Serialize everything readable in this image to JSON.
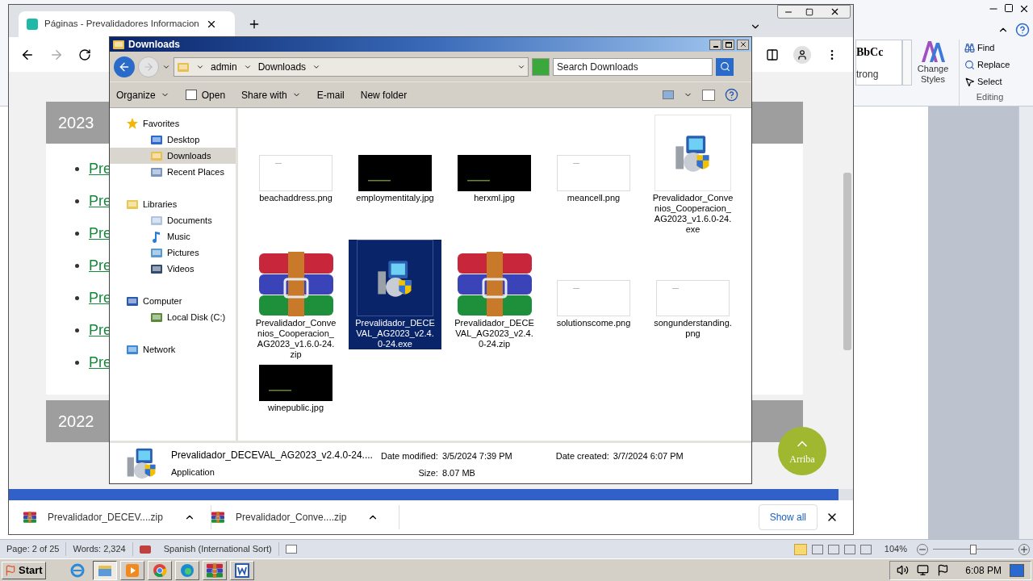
{
  "word": {
    "ribbon": {
      "style_preview": "BbCc",
      "style_name": "trong",
      "change_styles": "Change Styles",
      "find": "Find",
      "replace": "Replace",
      "select": "Select",
      "group_label": "Editing"
    },
    "status_bar": {
      "page": "Page: 2 of 25",
      "words": "Words: 2,324",
      "language": "Spanish (International Sort)",
      "zoom": "104%",
      "zoom_slider": {
        "level": 0.5
      }
    }
  },
  "browser": {
    "tab": {
      "title": "Páginas - Prevalidadores Informacion"
    },
    "sections": [
      {
        "year": "2023",
        "links": [
          "Pre",
          "Pre",
          "Pre",
          "Pre",
          "Pre",
          "Pre",
          "Pre"
        ]
      },
      {
        "year": "2022"
      }
    ],
    "back_to_top": "Arriba",
    "downloads": [
      {
        "name": "Prevalidador_DECEV....zip"
      },
      {
        "name": "Prevalidador_Conve....zip"
      }
    ],
    "show_all": "Show all"
  },
  "explorer": {
    "title": "Downloads",
    "breadcrumb": [
      "admin",
      "Downloads"
    ],
    "search": {
      "placeholder": "Search Downloads"
    },
    "toolbar": [
      {
        "label": "Organize",
        "kind": "menu"
      },
      {
        "label": "Open",
        "kind": "icon"
      },
      {
        "label": "Share with",
        "kind": "menu"
      },
      {
        "label": "E-mail",
        "kind": "plain"
      },
      {
        "label": "New folder",
        "kind": "plain"
      }
    ],
    "nav": [
      {
        "label": "Favorites",
        "kind": "star",
        "selected": false,
        "children": [
          {
            "label": "Desktop",
            "kind": "desktop",
            "selected": false
          },
          {
            "label": "Downloads",
            "kind": "downloads",
            "selected": true
          },
          {
            "label": "Recent Places",
            "kind": "recent",
            "selected": false
          }
        ]
      },
      {
        "label": "Libraries",
        "kind": "libraries",
        "selected": false,
        "children": [
          {
            "label": "Documents",
            "kind": "documents",
            "selected": false
          },
          {
            "label": "Music",
            "kind": "music",
            "selected": false
          },
          {
            "label": "Pictures",
            "kind": "pictures",
            "selected": false
          },
          {
            "label": "Videos",
            "kind": "videos",
            "selected": false
          }
        ]
      },
      {
        "label": "Computer",
        "kind": "computer",
        "selected": false,
        "children": [
          {
            "label": "Local Disk (C:)",
            "kind": "disk",
            "selected": false
          }
        ]
      },
      {
        "label": "Network",
        "kind": "network",
        "selected": false
      }
    ],
    "files": [
      {
        "name": "beachaddress.png",
        "kind": "light-image",
        "selected": false
      },
      {
        "name": "employmentitaly.jpg",
        "kind": "dark-image",
        "selected": false
      },
      {
        "name": "herxml.jpg",
        "kind": "dark-image",
        "selected": false
      },
      {
        "name": "meancell.png",
        "kind": "light-image",
        "selected": false
      },
      {
        "name": "Prevalidador_Convenios_Cooperacion_AG2023_v1.6.0-24.exe",
        "kind": "installer",
        "selected": false
      },
      {
        "name": "Prevalidador_Convenios_Cooperacion_AG2023_v1.6.0-24.zip",
        "kind": "archive",
        "selected": false
      },
      {
        "name": "Prevalidador_DECEVAL_AG2023_v2.4.0-24.exe",
        "kind": "installer",
        "selected": true
      },
      {
        "name": "Prevalidador_DECEVAL_AG2023_v2.4.0-24.zip",
        "kind": "archive",
        "selected": false
      },
      {
        "name": "solutionscome.png",
        "kind": "light-image",
        "selected": false
      },
      {
        "name": "songunderstanding.png",
        "kind": "light-image",
        "selected": false
      },
      {
        "name": "winepublic.jpg",
        "kind": "dark-image",
        "selected": false
      }
    ],
    "details": {
      "name": "Prevalidador_DECEVAL_AG2023_v2.4.0-24....",
      "type": "Application",
      "fields": [
        {
          "label": "Date modified:",
          "value": "3/5/2024 7:39 PM"
        },
        {
          "label": "Size:",
          "value": "8.07 MB"
        },
        {
          "label": "Date created:",
          "value": "3/7/2024 6:07 PM"
        }
      ]
    }
  },
  "taskbar": {
    "start": "Start",
    "clock": "6:08 PM",
    "apps": [
      {
        "kind": "ie",
        "active": false
      },
      {
        "kind": "explorer",
        "active": true
      },
      {
        "kind": "media",
        "active": false
      },
      {
        "kind": "chrome",
        "active": false
      },
      {
        "kind": "edge",
        "active": false
      },
      {
        "kind": "winrar",
        "active": false
      },
      {
        "kind": "word",
        "active": false
      }
    ]
  }
}
